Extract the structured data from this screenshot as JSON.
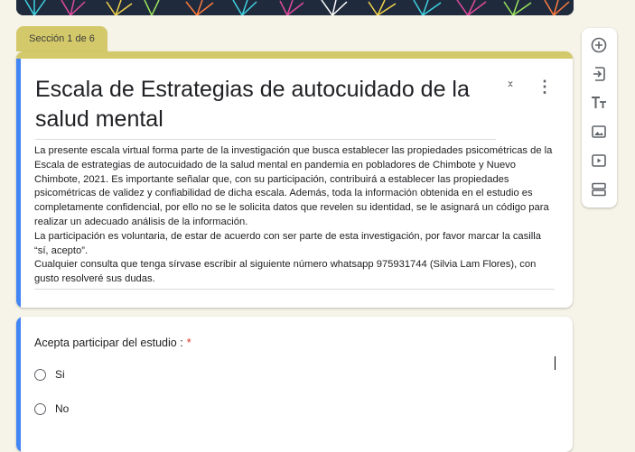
{
  "section": {
    "tab_label": "Sección 1 de 6"
  },
  "title_card": {
    "title": "Escala de Estrategias de autocuidado de la salud mental",
    "description": [
      "La presente escala virtual forma parte de la investigación que  busca  establecer las propiedades psicométricas  de la Escala de estrategias de autocuidado de la salud mental en pandemia en pobladores de Chimbote y Nuevo Chimbote,  2021. Es  importante señalar que, con su participación, contribuirá a  establecer las propiedades psicométricas de validez y confiabilidad de dicha escala. Además, toda la información obtenida en el estudio es completamente confidencial, por ello no se le solicita datos que revelen su identidad, se le asignará un código para realizar un adecuado análisis de la información.",
      "La participación es voluntaria,  de estar de acuerdo con ser parte de esta investigación,  por favor marcar la casilla “sí, acepto”.",
      "Cualquier consulta que tenga sírvase escribir al siguiente número whatsapp 975931744 (Silvia Lam Flores), con gusto resolveré sus dudas."
    ],
    "collapse_icon": "collapse-icon",
    "more_icon": "more-vert-icon"
  },
  "question": {
    "label": "Acepta participar del estudio :",
    "required_mark": "*",
    "options": [
      {
        "label": "Si"
      },
      {
        "label": "No"
      }
    ]
  },
  "toolbar": {
    "items": [
      {
        "name": "add-question",
        "icon": "add-circle-icon"
      },
      {
        "name": "import-questions",
        "icon": "import-icon"
      },
      {
        "name": "add-title",
        "icon": "title-icon"
      },
      {
        "name": "add-image",
        "icon": "image-icon"
      },
      {
        "name": "add-video",
        "icon": "video-icon"
      },
      {
        "name": "add-section",
        "icon": "section-icon"
      }
    ]
  },
  "colors": {
    "theme": "#d4c96a",
    "accent": "#4285f4",
    "background": "#f6f3e8",
    "required": "#d93025"
  }
}
